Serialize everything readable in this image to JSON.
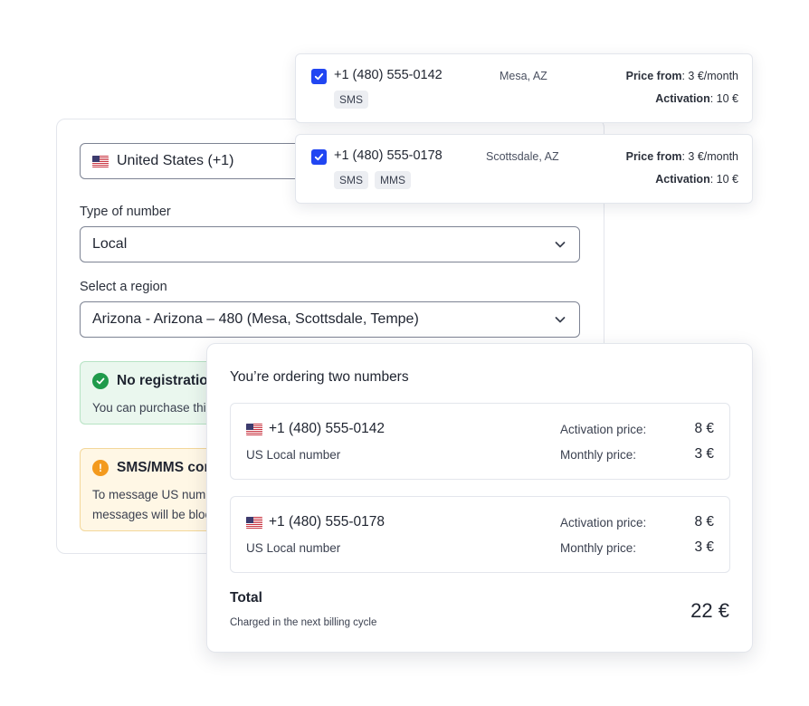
{
  "form": {
    "country": "United States (+1)",
    "type_label": "Type of number",
    "type_value": "Local",
    "region_label": "Select a region",
    "region_value": "Arizona - Arizona – 480 (Mesa, Scottsdale, Tempe)",
    "notice_green": {
      "title": "No registration",
      "body": "You can purchase this"
    },
    "notice_yellow": {
      "title": "SMS/MMS cor",
      "body_line1": "To message US numb",
      "body_line2": "messages will be bloc"
    }
  },
  "numbers": [
    {
      "phone": "+1 (480) 555-0142",
      "city": "Mesa, AZ",
      "tags": [
        "SMS"
      ],
      "price_label": "Price from",
      "price_value": ": 3 €/month",
      "activation_label": "Activation",
      "activation_value": ": 10 €",
      "checked": true
    },
    {
      "phone": "+1 (480) 555-0178",
      "city": "Scottsdale, AZ",
      "tags": [
        "SMS",
        "MMS"
      ],
      "price_label": "Price from",
      "price_value": ": 3 €/month",
      "activation_label": "Activation",
      "activation_value": ": 10 €",
      "checked": true
    }
  ],
  "order": {
    "title": "You’re ordering two numbers",
    "items": [
      {
        "phone": "+1 (480) 555-0142",
        "type": "US Local number",
        "activation_label": "Activation price:",
        "activation_value": "8 €",
        "monthly_label": "Monthly price:",
        "monthly_value": "3 €"
      },
      {
        "phone": "+1 (480) 555-0178",
        "type": "US Local number",
        "activation_label": "Activation price:",
        "activation_value": "8 €",
        "monthly_label": "Monthly price:",
        "monthly_value": "3 €"
      }
    ],
    "total_label": "Total",
    "total_sub": "Charged in the next billing cycle",
    "total_value": "22 €"
  },
  "icons": {
    "flag": "us-flag-icon",
    "chevron": "chevron-down-icon",
    "check": "check-icon",
    "success": "check-circle-icon",
    "warning": "exclamation-circle-icon"
  },
  "colors": {
    "accent": "#2146f2",
    "success": "#1f9a4b",
    "warning": "#f39a1d",
    "success_bg": "#eaf7ee",
    "warning_bg": "#fff7e5"
  }
}
